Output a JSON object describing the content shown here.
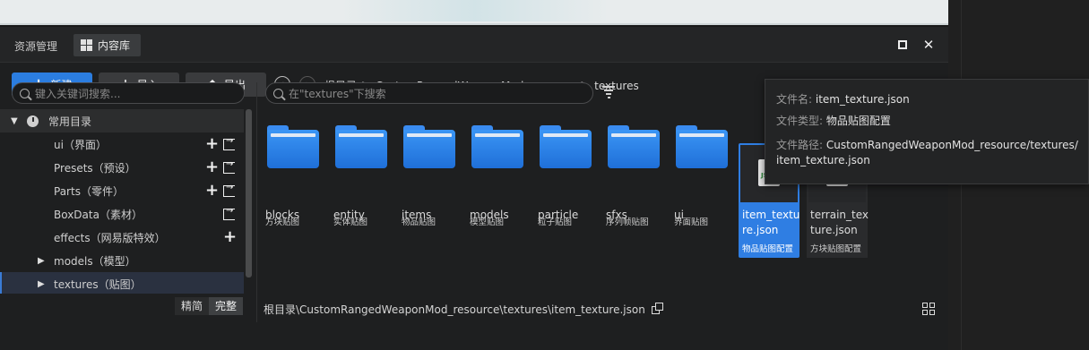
{
  "tabs": {
    "resource_mgmt": "资源管理",
    "content_lib": "内容库"
  },
  "toolbar": {
    "new_label": "新建",
    "import_label": "导入",
    "export_label": "导出"
  },
  "breadcrumb": [
    "根目录",
    "CustomRangedWeaponMod_resource",
    "textures"
  ],
  "breadcrumb_sep": ">",
  "left_search": {
    "placeholder": "键入关键词搜索..."
  },
  "right_search": {
    "placeholder": "在\"textures\"下搜索"
  },
  "tree": {
    "header": "常用目录",
    "items": [
      {
        "label": "ui（界面）"
      },
      {
        "label": "Presets（预设）"
      },
      {
        "label": "Parts（零件）"
      },
      {
        "label": "BoxData（素材）"
      },
      {
        "label": "effects（网易版特效）"
      },
      {
        "label": "models（模型）"
      },
      {
        "label": "textures（贴图）"
      }
    ]
  },
  "mode": {
    "simple": "精简",
    "full": "完整"
  },
  "items": [
    {
      "name": "blocks",
      "sub": "方块贴图"
    },
    {
      "name": "entity",
      "sub": "实体贴图"
    },
    {
      "name": "items",
      "sub": "物品贴图"
    },
    {
      "name": "models",
      "sub": "模型贴图"
    },
    {
      "name": "particle",
      "sub": "粒子贴图"
    },
    {
      "name": "sfxs",
      "sub": "序列帧贴图"
    },
    {
      "name": "ui",
      "sub": "界面贴图"
    },
    {
      "name": "item_texture.json",
      "sub": "物品贴图配置"
    },
    {
      "name": "terrain_texture.json",
      "sub": "方块贴图配置"
    }
  ],
  "file_badge": "JSON",
  "tooltip": {
    "name_key": "文件名:",
    "name_val": "item_texture.json",
    "type_key": "文件类型:",
    "type_val": "物品贴图配置",
    "path_key": "文件路径:",
    "path_val": "CustomRangedWeaponMod_resource/textures/item_texture.json"
  },
  "status": {
    "path": "根目录\\CustomRangedWeaponMod_resource\\textures\\item_texture.json"
  },
  "colors": {
    "accent": "#2b7de0",
    "panel": "#1e1f20"
  }
}
